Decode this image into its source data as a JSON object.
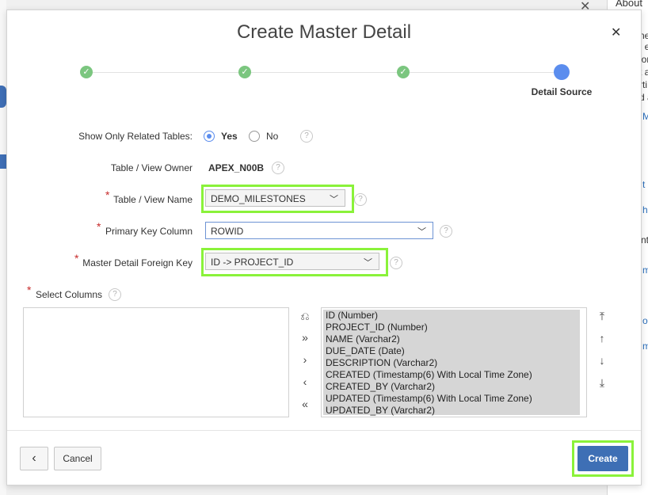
{
  "background": {
    "about_label": "About",
    "fragments": [
      "ne",
      ", e",
      "ion",
      "t a",
      "rti",
      "d a"
    ],
    "link_fragments": [
      "M",
      "t",
      "h",
      "nt",
      "m",
      "o",
      "m"
    ]
  },
  "dialog": {
    "title": "Create Master Detail",
    "close_icon": "close-icon",
    "wizard": {
      "steps": [
        "complete",
        "complete",
        "complete",
        "current"
      ],
      "current_label": "Detail Source"
    }
  },
  "form": {
    "related_tables": {
      "label": "Show Only Related Tables:",
      "options": [
        "Yes",
        "No"
      ],
      "selected": "Yes"
    },
    "owner": {
      "label": "Table / View Owner",
      "value": "APEX_N00B"
    },
    "table_name": {
      "label": "Table / View Name",
      "value": "DEMO_MILESTONES"
    },
    "primary_key": {
      "label": "Primary Key Column",
      "value": "ROWID"
    },
    "foreign_key": {
      "label": "Master Detail Foreign Key",
      "value": "ID -> PROJECT_ID"
    },
    "select_columns": {
      "label": "Select Columns",
      "available": [],
      "selected": [
        "ID (Number)",
        "PROJECT_ID (Number)",
        "NAME (Varchar2)",
        "DUE_DATE (Date)",
        "DESCRIPTION (Varchar2)",
        "CREATED (Timestamp(6) With Local Time Zone)",
        "CREATED_BY (Varchar2)",
        "UPDATED (Timestamp(6) With Local Time Zone)",
        "UPDATED_BY (Varchar2)"
      ]
    }
  },
  "footer": {
    "back_icon": "chevron-left-icon",
    "cancel_label": "Cancel",
    "create_label": "Create"
  },
  "colors": {
    "highlight": "#8af23a",
    "primary": "#3e6fb5",
    "step_complete": "#7bc67f",
    "step_current": "#5b8dee"
  }
}
